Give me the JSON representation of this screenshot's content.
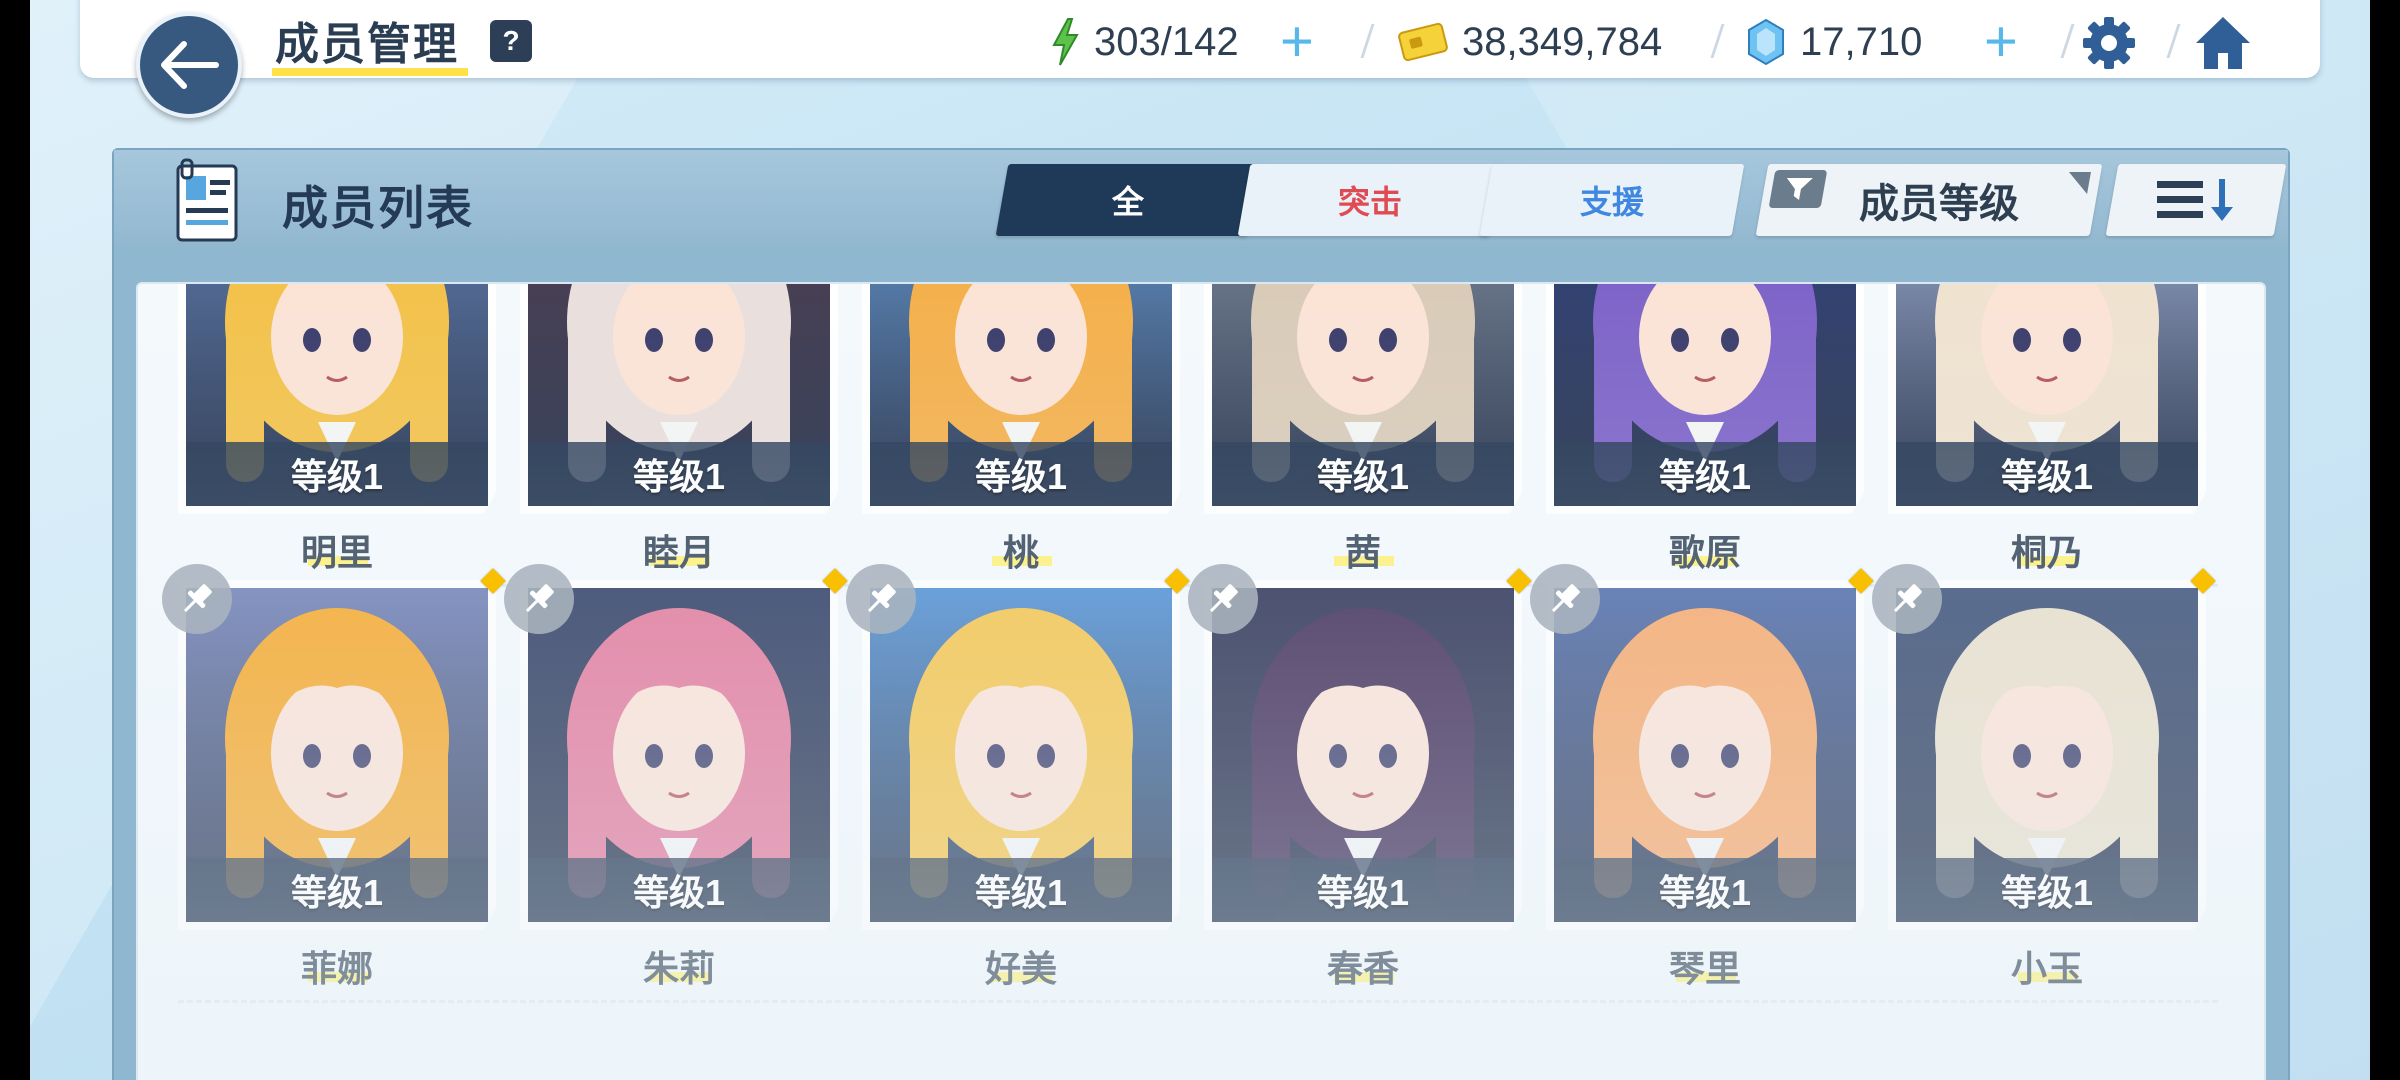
{
  "header": {
    "title": "成员管理",
    "help_label": "?",
    "ap": "303/142",
    "credits": "38,349,784",
    "gems": "17,710",
    "plus_label": "+"
  },
  "panel": {
    "title": "成员列表",
    "tabs": [
      {
        "label": "全",
        "active": true
      },
      {
        "label": "突击",
        "color": "#e04a52"
      },
      {
        "label": "支援",
        "color": "#3f87e0"
      }
    ],
    "sort_label": "成员等级"
  },
  "students": [
    {
      "name": "明里",
      "level": "等级1",
      "hair": "#f3c24b",
      "bg": "#6a87b8"
    },
    {
      "name": "睦月",
      "level": "等级1",
      "hair": "#e9dfdc",
      "bg": "#5d4a5c"
    },
    {
      "name": "桃",
      "level": "等级1",
      "hair": "#f4b04c",
      "bg": "#6fa0d6"
    },
    {
      "name": "茜",
      "level": "等级1",
      "hair": "#d9cbb8",
      "bg": "#8a98a8"
    },
    {
      "name": "歌原",
      "level": "等级1",
      "hair": "#7e64c8",
      "bg": "#3d4f88"
    },
    {
      "name": "桐乃",
      "level": "等级1",
      "hair": "#efe2cf",
      "bg": "#a7b6d8"
    },
    {
      "name": "菲娜",
      "level": "等级1",
      "hair": "#f6a727",
      "bg": "#6f7fb6"
    },
    {
      "name": "朱莉",
      "level": "等级1",
      "hair": "#e2789a",
      "bg": "#2c3a62"
    },
    {
      "name": "好美",
      "level": "等级1",
      "hair": "#f5c44a",
      "bg": "#4f8fd4"
    },
    {
      "name": "春香",
      "level": "等级1",
      "hair": "#3e2a55",
      "bg": "#2a2f52"
    },
    {
      "name": "琴里",
      "level": "等级1",
      "hair": "#f7a86a",
      "bg": "#4e6aa8"
    },
    {
      "name": "小玉",
      "level": "等级1",
      "hair": "#e8dfca",
      "bg": "#3a4f78"
    }
  ]
}
